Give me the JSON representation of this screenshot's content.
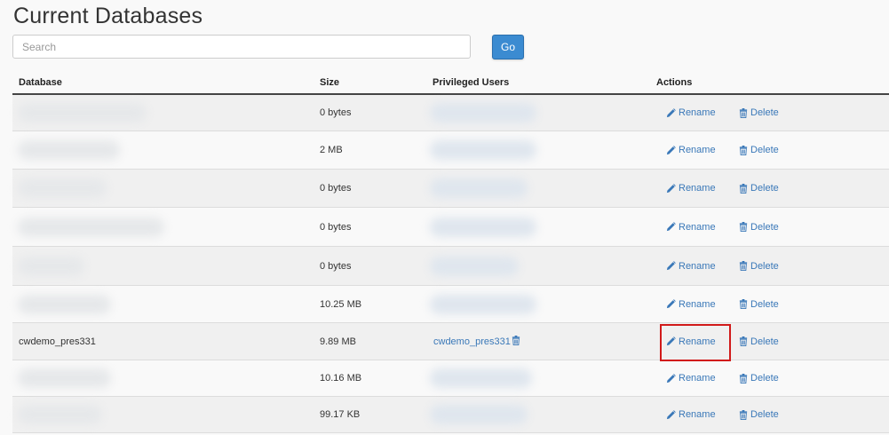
{
  "page": {
    "title": "Current Databases"
  },
  "search": {
    "placeholder": "Search",
    "value": "",
    "go_label": "Go"
  },
  "table": {
    "headers": {
      "database": "Database",
      "size": "Size",
      "privileged_users": "Privileged Users",
      "actions": "Actions"
    },
    "rename_label": "Rename",
    "delete_label": "Delete",
    "rows": [
      {
        "database": "",
        "size": "0 bytes",
        "user": "",
        "blurred": true
      },
      {
        "database": "",
        "size": "2 MB",
        "user": "",
        "blurred": true
      },
      {
        "database": "",
        "size": "0 bytes",
        "user": "",
        "blurred": true
      },
      {
        "database": "",
        "size": "0 bytes",
        "user": "",
        "blurred": true
      },
      {
        "database": "",
        "size": "0 bytes",
        "user": "",
        "blurred": true
      },
      {
        "database": "",
        "size": "10.25 MB",
        "user": "",
        "blurred": true
      },
      {
        "database": "cwdemo_pres331",
        "size": "9.89 MB",
        "user": "cwdemo_pres331",
        "blurred": false,
        "highlight_rename": true
      },
      {
        "database": "",
        "size": "10.16 MB",
        "user": "",
        "blurred": true
      },
      {
        "database": "",
        "size": "99.17 KB",
        "user": "",
        "blurred": true
      }
    ]
  },
  "colors": {
    "accent": "#3b8bd1",
    "link": "#3a78b8",
    "highlight": "#d11a1a"
  },
  "icons": {
    "rename": "pencil-icon",
    "delete": "trash-icon",
    "remove_user": "trash-icon"
  }
}
